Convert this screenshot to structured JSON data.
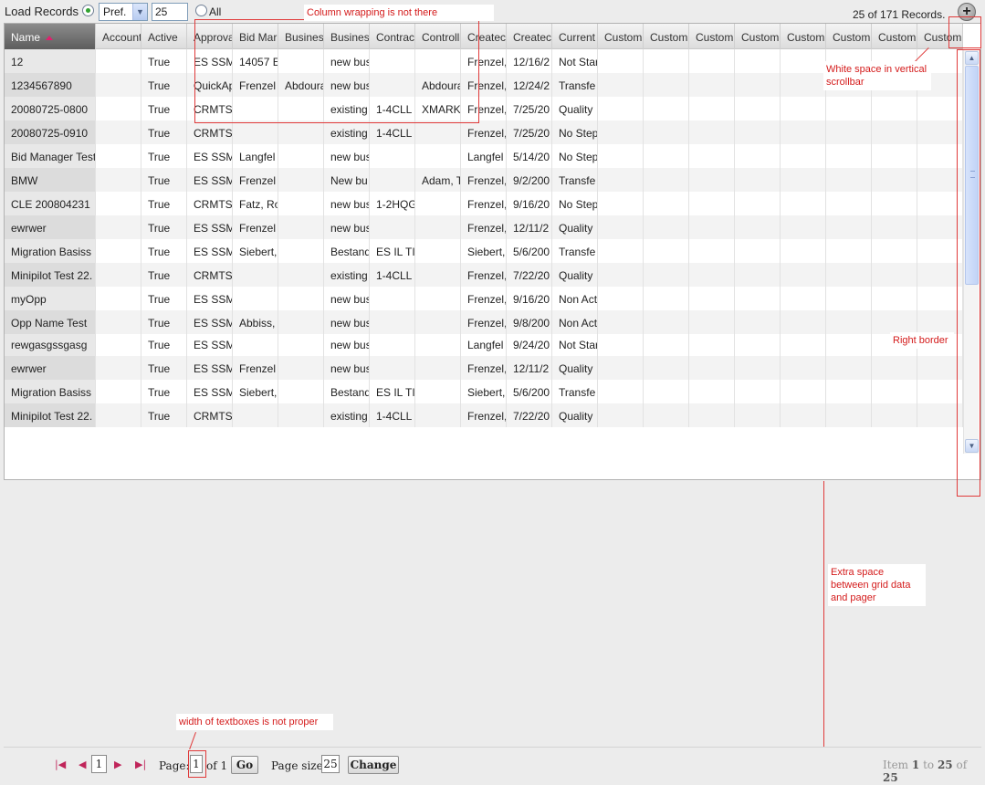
{
  "toolbar": {
    "load_records_label": "Load Records",
    "pref_value": "Pref.",
    "count_value": "25",
    "all_label": "All",
    "records_info": "25 of 171 Records.",
    "add_icon_glyph": "+"
  },
  "grid": {
    "columns": [
      "Name",
      "Account",
      "Active",
      "Approva",
      "Bid Mar",
      "Busines",
      "Busines",
      "Contrac",
      "Controll",
      "Createc",
      "Createc",
      "Current",
      "Custom",
      "Custom",
      "Custom",
      "Custom",
      "Custom",
      "Custom",
      "Custom",
      "Custom"
    ],
    "rows": [
      [
        "12",
        "",
        "True",
        "ES SSM",
        "14057 E",
        "",
        "new bus",
        "",
        "",
        "Frenzel,",
        "12/16/2",
        "Not Star"
      ],
      [
        "1234567890",
        "",
        "True",
        "QuickAp",
        "Frenzel",
        "Abdoura",
        "new bus",
        "",
        "Abdoura",
        "Frenzel,",
        "12/24/2",
        "Transfe"
      ],
      [
        "20080725-0800",
        "",
        "True",
        "CRMTS",
        "",
        "",
        "existing",
        "1-4CLL",
        "XMARKT",
        "Frenzel,",
        "7/25/20",
        "Quality"
      ],
      [
        "20080725-0910",
        "",
        "True",
        "CRMTS",
        "",
        "",
        "existing",
        "1-4CLL",
        "",
        "Frenzel,",
        "7/25/20",
        "No Step"
      ],
      [
        "Bid Manager Test",
        "",
        "True",
        "ES SSM",
        "Langfel",
        "",
        "new bus",
        "",
        "",
        "Langfel",
        "5/14/20",
        "No Step"
      ],
      [
        "BMW",
        "",
        "True",
        "ES SSM",
        "Frenzel",
        "",
        "New bu",
        "",
        "Adam, T",
        "Frenzel,",
        "9/2/200",
        "Transfe"
      ],
      [
        "CLE 200804231",
        "",
        "True",
        "CRMTS",
        "Fatz, Ro",
        "",
        "new bus",
        "1-2HQG",
        "",
        "Frenzel,",
        "9/16/20",
        "No Step"
      ],
      [
        "ewrwer",
        "",
        "True",
        "ES SSM",
        "Frenzel",
        "",
        "new bus",
        "",
        "",
        "Frenzel,",
        "12/11/2",
        "Quality"
      ],
      [
        "Migration Basiss",
        "",
        "True",
        "ES SSM",
        "Siebert,",
        "",
        "Bestand",
        "ES IL TI",
        "",
        "Siebert,",
        "5/6/200",
        "Transfe"
      ],
      [
        "Minipilot Test 22.",
        "",
        "True",
        "CRMTS",
        "",
        "",
        "existing",
        "1-4CLL",
        "",
        "Frenzel,",
        "7/22/20",
        "Quality"
      ],
      [
        "myOpp",
        "",
        "True",
        "ES SSM",
        "",
        "",
        "new bus",
        "",
        "",
        "Frenzel,",
        "9/16/20",
        "Non Act"
      ],
      [
        "Opp Name Test",
        "",
        "True",
        "ES SSM",
        "Abbiss,",
        "",
        "new bus",
        "",
        "",
        "Frenzel,",
        "9/8/200",
        "Non Act"
      ],
      [
        "rewgasgssgasg",
        "",
        "True",
        "ES SSM",
        "",
        "",
        "new bus",
        "",
        "",
        "Langfel",
        "9/24/20",
        "Not Star"
      ],
      [
        "ewrwer",
        "",
        "True",
        "ES SSM",
        "Frenzel",
        "",
        "new bus",
        "",
        "",
        "Frenzel,",
        "12/11/2",
        "Quality"
      ],
      [
        "Migration Basiss",
        "",
        "True",
        "ES SSM",
        "Siebert,",
        "",
        "Bestand",
        "ES IL TI",
        "",
        "Siebert,",
        "5/6/200",
        "Transfe"
      ],
      [
        "Minipilot Test 22.",
        "",
        "True",
        "CRMTS",
        "",
        "",
        "existing",
        "1-4CLL",
        "",
        "Frenzel,",
        "7/22/20",
        "Quality"
      ]
    ]
  },
  "pager": {
    "first_icon": "|◀",
    "prev_icon": "◀",
    "current_page_box": "1",
    "next_icon": "▶",
    "last_icon": "▶|",
    "page_label": "Page:",
    "page_value": "1",
    "of_label": "of 1",
    "go_label": "Go",
    "page_size_label": "Page size:",
    "page_size_value": "25",
    "change_label": "Change",
    "item_prefix": "Item",
    "item_from": "1",
    "item_to_word": "to",
    "item_to": "25",
    "item_of_word": "of",
    "item_total": "25"
  },
  "annotations": {
    "column_wrapping": "Column wrapping is not there",
    "white_space_scrollbar": "White space in vertical scrollbar",
    "right_border": "Right border",
    "extra_space": "Extra space between grid data and pager",
    "textbox_width": "width of textboxes is not proper"
  },
  "colors": {
    "annotation": "#e03a3a",
    "sort_arrow": "#e0206e",
    "radio_checked": "#31a231"
  }
}
